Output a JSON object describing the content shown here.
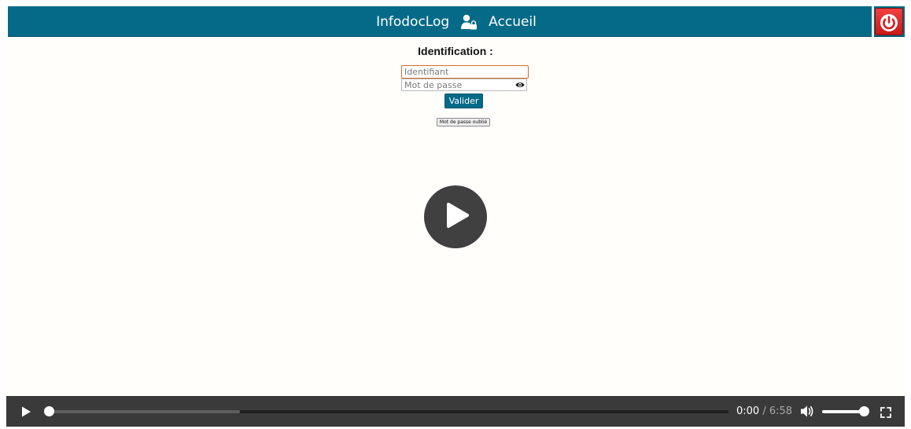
{
  "header": {
    "app_name": "InfodocLog",
    "home_label": "Accueil",
    "icons": {
      "user": "user-lock-icon",
      "logout": "power-icon"
    },
    "colors": {
      "bar": "#056a88",
      "logout": "#d42020"
    }
  },
  "login": {
    "title": "Identification :",
    "username_placeholder": "Identifiant",
    "password_placeholder": "Mot de passe",
    "show_password_icon": "eye-icon",
    "submit_label": "Valider",
    "forgot_label": "Mot de passe oublié"
  },
  "video": {
    "big_play_icon": "play-icon",
    "current_time": "0:00",
    "separator": "/",
    "duration": "6:58",
    "progress_fraction": 0.0,
    "buffered_fraction": 0.28,
    "volume_fraction": 1.0,
    "icons": {
      "play": "play-icon",
      "volume": "volume-icon",
      "fullscreen": "fullscreen-icon"
    }
  }
}
